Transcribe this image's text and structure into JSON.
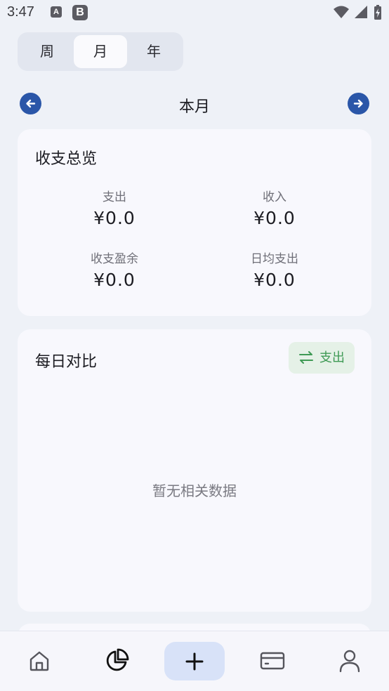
{
  "status_bar": {
    "time": "3:47",
    "notifications": [
      "A",
      "B"
    ],
    "icons": [
      "wifi-icon",
      "signal-icon",
      "battery-charging-icon"
    ]
  },
  "period_tabs": [
    {
      "label": "周",
      "active": false
    },
    {
      "label": "月",
      "active": true
    },
    {
      "label": "年",
      "active": false
    }
  ],
  "period_nav": {
    "title": "本月",
    "prev_icon": "arrow-left-icon",
    "next_icon": "arrow-right-icon"
  },
  "overview": {
    "title": "收支总览",
    "stats": [
      {
        "label": "支出",
        "value": "¥0.0"
      },
      {
        "label": "收入",
        "value": "¥0.0"
      },
      {
        "label": "收支盈余",
        "value": "¥0.0"
      },
      {
        "label": "日均支出",
        "value": "¥0.0"
      }
    ]
  },
  "daily": {
    "title": "每日对比",
    "toggle_label": "支出",
    "toggle_icon": "swap-icon",
    "empty_text": "暂无相关数据"
  },
  "bottom_nav": [
    {
      "icon": "home-icon",
      "active": false
    },
    {
      "icon": "pie-chart-icon",
      "active": true
    },
    {
      "icon": "plus-icon",
      "active": false
    },
    {
      "icon": "card-icon",
      "active": false
    },
    {
      "icon": "user-icon",
      "active": false
    }
  ],
  "colors": {
    "background": "#eef1f7",
    "card": "#f8f8fd",
    "accent": "#2a56a8",
    "toggle_bg": "#e5f1e7",
    "toggle_text": "#3f9a55",
    "add_button_bg": "#d8e2f8"
  }
}
